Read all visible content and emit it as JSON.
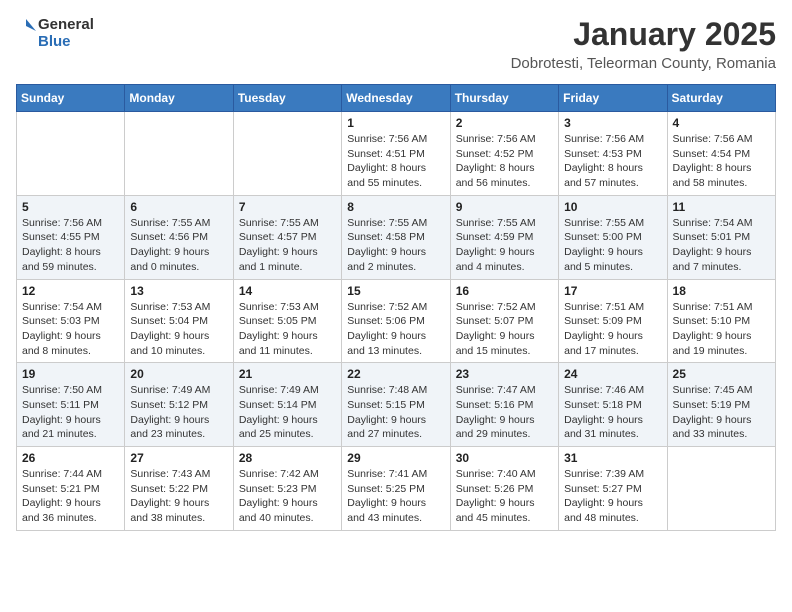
{
  "header": {
    "logo_general": "General",
    "logo_blue": "Blue",
    "month_year": "January 2025",
    "location": "Dobrotesti, Teleorman County, Romania"
  },
  "days_of_week": [
    "Sunday",
    "Monday",
    "Tuesday",
    "Wednesday",
    "Thursday",
    "Friday",
    "Saturday"
  ],
  "weeks": [
    [
      {
        "day": "",
        "info": ""
      },
      {
        "day": "",
        "info": ""
      },
      {
        "day": "",
        "info": ""
      },
      {
        "day": "1",
        "info": "Sunrise: 7:56 AM\nSunset: 4:51 PM\nDaylight: 8 hours\nand 55 minutes."
      },
      {
        "day": "2",
        "info": "Sunrise: 7:56 AM\nSunset: 4:52 PM\nDaylight: 8 hours\nand 56 minutes."
      },
      {
        "day": "3",
        "info": "Sunrise: 7:56 AM\nSunset: 4:53 PM\nDaylight: 8 hours\nand 57 minutes."
      },
      {
        "day": "4",
        "info": "Sunrise: 7:56 AM\nSunset: 4:54 PM\nDaylight: 8 hours\nand 58 minutes."
      }
    ],
    [
      {
        "day": "5",
        "info": "Sunrise: 7:56 AM\nSunset: 4:55 PM\nDaylight: 8 hours\nand 59 minutes."
      },
      {
        "day": "6",
        "info": "Sunrise: 7:55 AM\nSunset: 4:56 PM\nDaylight: 9 hours\nand 0 minutes."
      },
      {
        "day": "7",
        "info": "Sunrise: 7:55 AM\nSunset: 4:57 PM\nDaylight: 9 hours\nand 1 minute."
      },
      {
        "day": "8",
        "info": "Sunrise: 7:55 AM\nSunset: 4:58 PM\nDaylight: 9 hours\nand 2 minutes."
      },
      {
        "day": "9",
        "info": "Sunrise: 7:55 AM\nSunset: 4:59 PM\nDaylight: 9 hours\nand 4 minutes."
      },
      {
        "day": "10",
        "info": "Sunrise: 7:55 AM\nSunset: 5:00 PM\nDaylight: 9 hours\nand 5 minutes."
      },
      {
        "day": "11",
        "info": "Sunrise: 7:54 AM\nSunset: 5:01 PM\nDaylight: 9 hours\nand 7 minutes."
      }
    ],
    [
      {
        "day": "12",
        "info": "Sunrise: 7:54 AM\nSunset: 5:03 PM\nDaylight: 9 hours\nand 8 minutes."
      },
      {
        "day": "13",
        "info": "Sunrise: 7:53 AM\nSunset: 5:04 PM\nDaylight: 9 hours\nand 10 minutes."
      },
      {
        "day": "14",
        "info": "Sunrise: 7:53 AM\nSunset: 5:05 PM\nDaylight: 9 hours\nand 11 minutes."
      },
      {
        "day": "15",
        "info": "Sunrise: 7:52 AM\nSunset: 5:06 PM\nDaylight: 9 hours\nand 13 minutes."
      },
      {
        "day": "16",
        "info": "Sunrise: 7:52 AM\nSunset: 5:07 PM\nDaylight: 9 hours\nand 15 minutes."
      },
      {
        "day": "17",
        "info": "Sunrise: 7:51 AM\nSunset: 5:09 PM\nDaylight: 9 hours\nand 17 minutes."
      },
      {
        "day": "18",
        "info": "Sunrise: 7:51 AM\nSunset: 5:10 PM\nDaylight: 9 hours\nand 19 minutes."
      }
    ],
    [
      {
        "day": "19",
        "info": "Sunrise: 7:50 AM\nSunset: 5:11 PM\nDaylight: 9 hours\nand 21 minutes."
      },
      {
        "day": "20",
        "info": "Sunrise: 7:49 AM\nSunset: 5:12 PM\nDaylight: 9 hours\nand 23 minutes."
      },
      {
        "day": "21",
        "info": "Sunrise: 7:49 AM\nSunset: 5:14 PM\nDaylight: 9 hours\nand 25 minutes."
      },
      {
        "day": "22",
        "info": "Sunrise: 7:48 AM\nSunset: 5:15 PM\nDaylight: 9 hours\nand 27 minutes."
      },
      {
        "day": "23",
        "info": "Sunrise: 7:47 AM\nSunset: 5:16 PM\nDaylight: 9 hours\nand 29 minutes."
      },
      {
        "day": "24",
        "info": "Sunrise: 7:46 AM\nSunset: 5:18 PM\nDaylight: 9 hours\nand 31 minutes."
      },
      {
        "day": "25",
        "info": "Sunrise: 7:45 AM\nSunset: 5:19 PM\nDaylight: 9 hours\nand 33 minutes."
      }
    ],
    [
      {
        "day": "26",
        "info": "Sunrise: 7:44 AM\nSunset: 5:21 PM\nDaylight: 9 hours\nand 36 minutes."
      },
      {
        "day": "27",
        "info": "Sunrise: 7:43 AM\nSunset: 5:22 PM\nDaylight: 9 hours\nand 38 minutes."
      },
      {
        "day": "28",
        "info": "Sunrise: 7:42 AM\nSunset: 5:23 PM\nDaylight: 9 hours\nand 40 minutes."
      },
      {
        "day": "29",
        "info": "Sunrise: 7:41 AM\nSunset: 5:25 PM\nDaylight: 9 hours\nand 43 minutes."
      },
      {
        "day": "30",
        "info": "Sunrise: 7:40 AM\nSunset: 5:26 PM\nDaylight: 9 hours\nand 45 minutes."
      },
      {
        "day": "31",
        "info": "Sunrise: 7:39 AM\nSunset: 5:27 PM\nDaylight: 9 hours\nand 48 minutes."
      },
      {
        "day": "",
        "info": ""
      }
    ]
  ]
}
